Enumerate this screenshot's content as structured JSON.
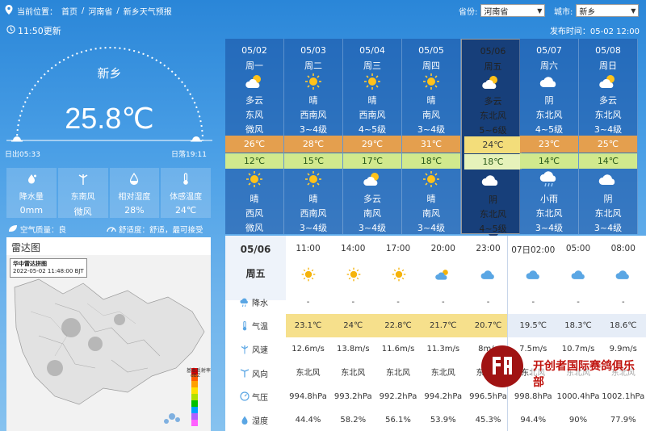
{
  "breadcrumb": {
    "prefix": "当前位置：",
    "items": [
      "首页",
      "河南省",
      "新乡天气预报"
    ],
    "separator": "/"
  },
  "selectors": {
    "province_label": "省份:",
    "province_value": "河南省",
    "city_label": "城市:",
    "city_value": "新乡"
  },
  "update_time": "11:50更新",
  "publish_time": "发布时间：05-02 12:00",
  "current": {
    "city": "新乡",
    "temp": "25.8℃",
    "sunrise": "日出05:33",
    "sunset": "日落19:11"
  },
  "stats": [
    {
      "icon": "raindrop-icon",
      "label": "降水量",
      "value": "0mm"
    },
    {
      "icon": "wind-turbine-icon",
      "label": "东南风",
      "value": "微风"
    },
    {
      "icon": "humidity-icon",
      "label": "相对湿度",
      "value": "28%"
    },
    {
      "icon": "thermometer-icon",
      "label": "体感温度",
      "value": "24℃"
    }
  ],
  "air": {
    "aq_text": "空气质量：良",
    "comfort_text": "舒适度：舒适，最可接受"
  },
  "radar": {
    "title": "雷达图",
    "caption_title": "华中雷达拼图",
    "caption_time": "2022-05-02 11:48:00 BJT",
    "legend_title": "基本反射率",
    "legend_unit": "dBZ"
  },
  "forecast": [
    {
      "date": "05/02",
      "week": "周一",
      "day_icon": "partly-cloudy-icon",
      "day_wx": "多云",
      "day_wind": "东风",
      "day_level": "微风",
      "hi": "26℃",
      "lo": "12℃",
      "night_icon": "sunny-icon",
      "night_wx": "晴",
      "night_wind": "西风",
      "night_level": "微风",
      "selected": false
    },
    {
      "date": "05/03",
      "week": "周二",
      "day_icon": "sunny-icon",
      "day_wx": "晴",
      "day_wind": "西南风",
      "day_level": "3~4级",
      "hi": "28℃",
      "lo": "15℃",
      "night_icon": "sunny-icon",
      "night_wx": "晴",
      "night_wind": "西南风",
      "night_level": "3~4级",
      "selected": false
    },
    {
      "date": "05/04",
      "week": "周三",
      "day_icon": "sunny-icon",
      "day_wx": "晴",
      "day_wind": "西南风",
      "day_level": "4~5级",
      "hi": "29℃",
      "lo": "17℃",
      "night_icon": "partly-cloudy-icon",
      "night_wx": "多云",
      "night_wind": "南风",
      "night_level": "3~4级",
      "selected": false
    },
    {
      "date": "05/05",
      "week": "周四",
      "day_icon": "sunny-icon",
      "day_wx": "晴",
      "day_wind": "南风",
      "day_level": "3~4级",
      "hi": "31℃",
      "lo": "18℃",
      "night_icon": "sunny-icon",
      "night_wx": "晴",
      "night_wind": "南风",
      "night_level": "3~4级",
      "selected": false
    },
    {
      "date": "05/06",
      "week": "周五",
      "day_icon": "partly-cloudy-icon",
      "day_wx": "多云",
      "day_wind": "东北风",
      "day_level": "5~6级",
      "hi": "24℃",
      "lo": "18℃",
      "night_icon": "cloudy-icon",
      "night_wx": "阴",
      "night_wind": "东北风",
      "night_level": "4~5级",
      "selected": true
    },
    {
      "date": "05/07",
      "week": "周六",
      "day_icon": "cloudy-icon",
      "day_wx": "阴",
      "day_wind": "东北风",
      "day_level": "4~5级",
      "hi": "23℃",
      "lo": "14℃",
      "night_icon": "light-rain-icon",
      "night_wx": "小雨",
      "night_wind": "东北风",
      "night_level": "3~4级",
      "selected": false
    },
    {
      "date": "05/08",
      "week": "周日",
      "day_icon": "partly-cloudy-icon",
      "day_wx": "多云",
      "day_wind": "东北风",
      "day_level": "3~4级",
      "hi": "25℃",
      "lo": "14℃",
      "night_icon": "cloudy-icon",
      "night_wx": "阴",
      "night_wind": "东北风",
      "night_level": "3~4级",
      "selected": false
    }
  ],
  "hourly": {
    "date": "05/06",
    "week": "周五",
    "times": [
      "11:00",
      "14:00",
      "17:00",
      "20:00",
      "23:00",
      "07日02:00",
      "05:00",
      "08:00"
    ],
    "icons": [
      "sunny-icon",
      "sunny-icon",
      "sunny-icon",
      "partly-cloudy-night-icon",
      "cloudy-icon",
      "cloudy-icon",
      "cloudy-icon",
      "cloudy-icon"
    ],
    "rows": [
      {
        "label": "降水",
        "icon": "rain-cloud-icon",
        "values": [
          "-",
          "-",
          "-",
          "-",
          "-",
          "-",
          "-",
          "-"
        ]
      },
      {
        "label": "气温",
        "icon": "thermometer-icon",
        "values": [
          "23.1℃",
          "24℃",
          "22.8℃",
          "21.7℃",
          "20.7℃",
          "19.5℃",
          "18.3℃",
          "18.6℃"
        ]
      },
      {
        "label": "风速",
        "icon": "wind-speed-icon",
        "values": [
          "12.6m/s",
          "13.8m/s",
          "11.6m/s",
          "11.3m/s",
          "8m/s",
          "7.5m/s",
          "10.7m/s",
          "9.9m/s"
        ]
      },
      {
        "label": "风向",
        "icon": "wind-direction-icon",
        "values": [
          "东北风",
          "东北风",
          "东北风",
          "东北风",
          "东北风",
          "东北风",
          "东北风",
          "东北风"
        ]
      },
      {
        "label": "气压",
        "icon": "pressure-icon",
        "values": [
          "994.8hPa",
          "993.2hPa",
          "992.2hPa",
          "994.2hPa",
          "996.5hPa",
          "998.8hPa",
          "1000.4hPa",
          "1002.1hPa"
        ]
      },
      {
        "label": "湿度",
        "icon": "humidity-icon",
        "values": [
          "44.4%",
          "58.2%",
          "56.1%",
          "53.9%",
          "45.3%",
          "94.4%",
          "90%",
          "77.9%"
        ]
      }
    ]
  },
  "watermark": {
    "seal_text": "翔",
    "text": "开创者国际赛鸽俱乐部"
  },
  "colors": {
    "high_temp": "#e49f4e",
    "low_temp": "#d1e98d",
    "selected_col": "#173f7a",
    "hourly_temp_band": "#f6e08c"
  }
}
